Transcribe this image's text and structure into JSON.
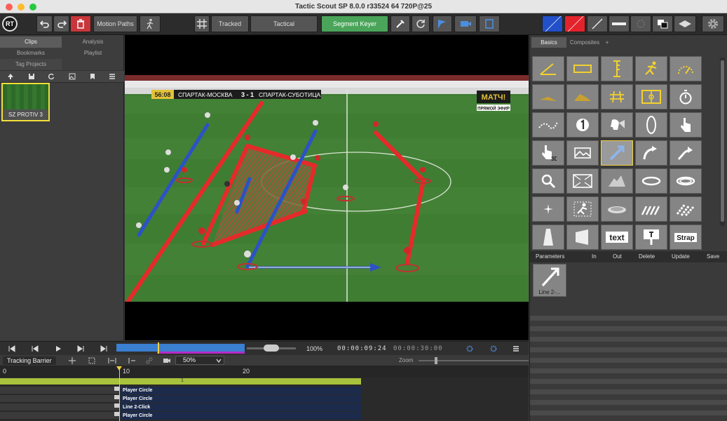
{
  "window": {
    "title": "Tactic Scout SP 8.0.0 r33524 64 720P@25"
  },
  "toolbar": {
    "logo": "RT",
    "motion_paths": "Motion Paths",
    "tracked": "Tracked",
    "tactical": "Tactical",
    "segment_keyer": "Segment Keyer"
  },
  "left": {
    "tabs": [
      "Clips",
      "Analysis",
      "Bookmarks",
      "Playlist",
      "Tag Projects"
    ],
    "clip": {
      "label": "SZ PROTIV 3"
    }
  },
  "video": {
    "score": {
      "time": "56:08",
      "home": "СПАРТАК-МОСКВА",
      "score": "3 - 1",
      "away": "СПАРТАК-СУБОТИЦА"
    },
    "broadcaster": "МАТЧ!",
    "live": "ПРЯМОЙ ЭФИР"
  },
  "right": {
    "tabs": [
      "Basics",
      "Composites",
      "+"
    ],
    "tool_text": "text",
    "tool_strap": "Strap",
    "params": {
      "title": "Parameters",
      "in": "In",
      "out": "Out",
      "delete": "Delete",
      "update": "Update",
      "save": "Save"
    },
    "param_item": "Line 2-..."
  },
  "transport": {
    "zoom_pct": "100%",
    "time_current": "00:00:09:24",
    "time_total": "00:00:30:00"
  },
  "timeline": {
    "tracking_barrier": "Tracking Barrier",
    "zoom_select": "50%",
    "zoom_label": "Zoom",
    "ruler": [
      "0",
      "10",
      "20"
    ],
    "marker": "1",
    "tracks": [
      "Player Circle",
      "Player Circle",
      "Line 2-Click",
      "Player Circle"
    ]
  }
}
